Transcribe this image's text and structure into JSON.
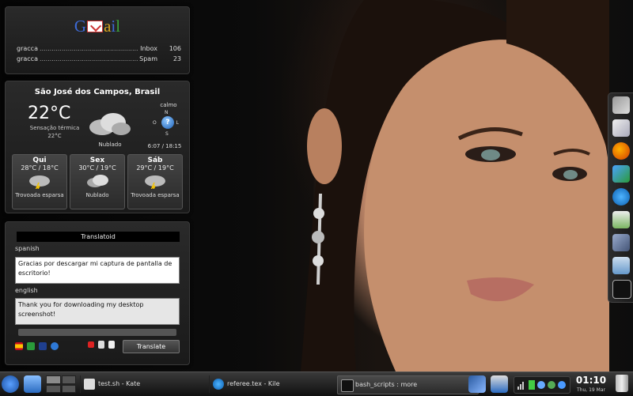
{
  "gmail": {
    "logo_letters": [
      "G",
      "a",
      "i",
      "l"
    ],
    "rows": [
      {
        "account": "gracca",
        "dots": "..................................................",
        "box": "Inbox",
        "count": "106"
      },
      {
        "account": "gracca",
        "dots": "..................................................",
        "box": "Spam",
        "count": "23"
      }
    ]
  },
  "weather": {
    "location": "São José dos Campos, Brasil",
    "temperature": "22°C",
    "feels_label": "Sensação térmica",
    "feels_value": "22°C",
    "condition": "Nublado",
    "wind": "calmo",
    "compass": {
      "n": "N",
      "s": "S",
      "o": "O",
      "l": "L",
      "center": "?"
    },
    "sun_times": "6:07 / 18:15",
    "forecast": [
      {
        "day": "Qui",
        "range": "28°C / 18°C",
        "condition": "Trovoada esparsa"
      },
      {
        "day": "Sex",
        "range": "30°C / 19°C",
        "condition": "Nublado"
      },
      {
        "day": "Sáb",
        "range": "29°C / 19°C",
        "condition": "Trovoada esparsa"
      }
    ]
  },
  "translatoid": {
    "title": "Translatoid",
    "source_lang": "spanish",
    "source_text": "Gracias por descargar mi captura de pantalla de escritorio!",
    "target_lang": "english",
    "target_text": "Thank you for downloading my desktop screenshot!",
    "translate_label": "Translate"
  },
  "taskbar": {
    "tasks": [
      {
        "label": "test.sh - Kate",
        "icon": "kate-icon"
      },
      {
        "label": "referee.tex - Kile",
        "icon": "kile-icon"
      },
      {
        "label": "bash_scripts : more",
        "icon": "terminal-icon"
      }
    ],
    "clock_time": "01:10",
    "clock_date": "Thu, 19 Mar"
  },
  "colors": {
    "panel_bg": "#222222",
    "taskbar_bg": "#1c1c1c",
    "accent_blue": "#1d5fb4"
  }
}
